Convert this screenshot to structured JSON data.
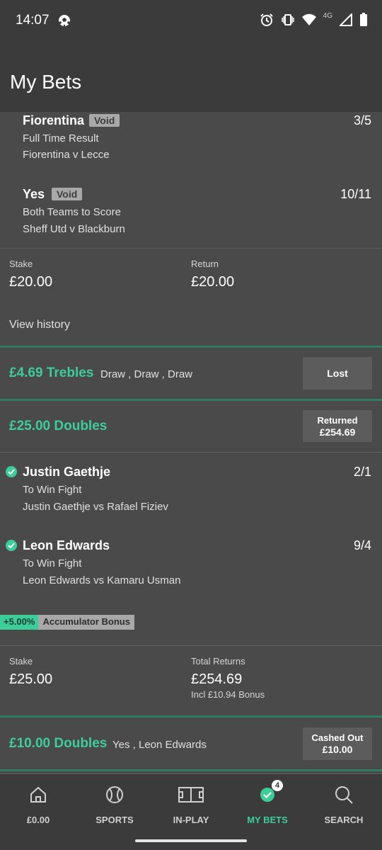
{
  "status_bar": {
    "time": "14:07",
    "network": "4G"
  },
  "header": {
    "title": "My Bets"
  },
  "bet1": {
    "selections": [
      {
        "name": "Fiorentina",
        "badge": "Void",
        "odds": "3/5",
        "market": "Full Time Result",
        "event": "Fiorentina v Lecce"
      },
      {
        "name": "Yes",
        "badge": "Void",
        "odds": "10/11",
        "market": "Both Teams to Score",
        "event": "Sheff Utd v Blackburn"
      }
    ],
    "stake_label": "Stake",
    "stake": "£20.00",
    "return_label": "Return",
    "return": "£20.00",
    "view_history": "View history"
  },
  "bet2": {
    "title": "£4.69 Trebles",
    "legs": "Draw , Draw , Draw",
    "status": "Lost"
  },
  "bet3": {
    "title": "£25.00 Doubles",
    "status_line1": "Returned",
    "status_line2": "£254.69",
    "selections": [
      {
        "name": "Justin Gaethje",
        "odds": "2/1",
        "market": "To Win Fight",
        "event": "Justin Gaethje vs Rafael Fiziev"
      },
      {
        "name": "Leon Edwards",
        "odds": "9/4",
        "market": "To Win Fight",
        "event": "Leon Edwards vs Kamaru Usman"
      }
    ],
    "bonus_pct": "+5.00%",
    "bonus_label": "Accumulator Bonus",
    "stake_label": "Stake",
    "stake": "£25.00",
    "returns_label": "Total Returns",
    "returns": "£254.69",
    "returns_note": "Incl £10.94 Bonus"
  },
  "bet4": {
    "title": "£10.00 Doubles",
    "legs": "Yes , Leon Edwards",
    "status_line1": "Cashed Out",
    "status_line2": "£10.00"
  },
  "nav": {
    "items": [
      {
        "label": "£0.00",
        "icon": "home-icon"
      },
      {
        "label": "SPORTS",
        "icon": "sports-ball-icon"
      },
      {
        "label": "IN-PLAY",
        "icon": "pitch-icon"
      },
      {
        "label": "MY BETS",
        "icon": "check-circle-icon"
      },
      {
        "label": "SEARCH",
        "icon": "search-icon"
      }
    ],
    "active": "MY BETS",
    "my_bets_count": "4"
  },
  "colors": {
    "accent": "#3dcd9b",
    "background": "#4a4a4a",
    "header": "#3b3b3b",
    "badge": "#a8a8a8"
  }
}
